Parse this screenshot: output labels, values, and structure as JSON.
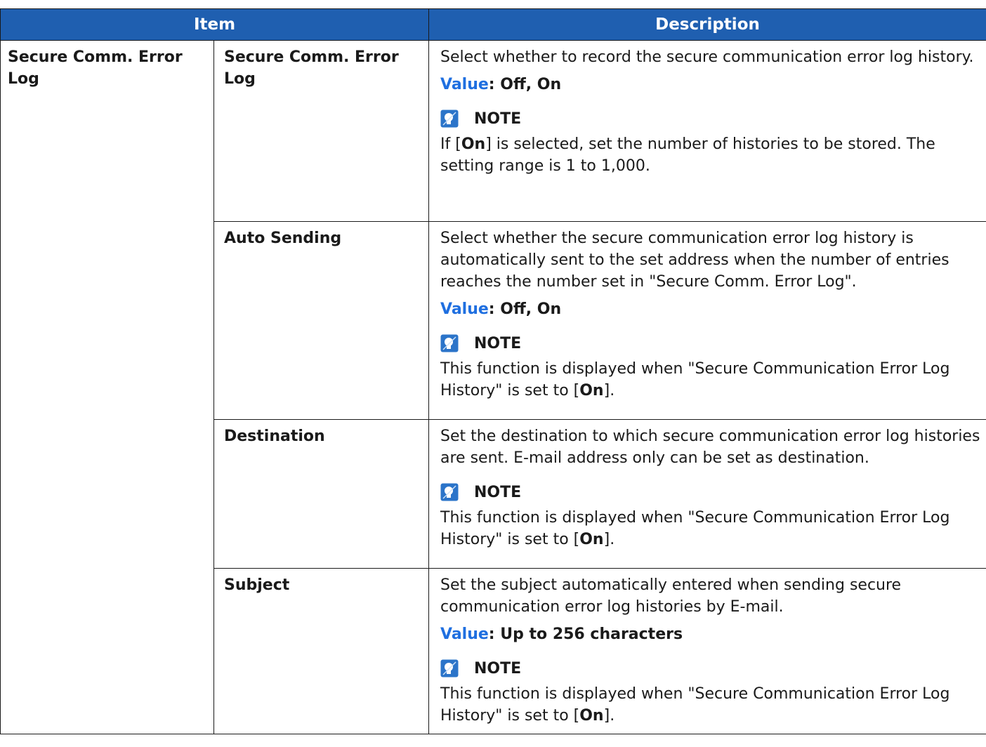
{
  "header": {
    "item": "Item",
    "description": "Description"
  },
  "group": "Secure Comm. Error Log",
  "note_label": "NOTE",
  "value_key": "Value",
  "rows": [
    {
      "item": "Secure Comm. Error Log",
      "text": "Select whether to record the secure communication error log history.",
      "value": ": Off, On",
      "note": [
        "If [",
        "On",
        "] is selected, set the number of histories to be stored. The setting range is 1 to 1,000."
      ]
    },
    {
      "item": "Auto Sending",
      "text": "Select whether the secure communication error log history is automatically sent to the set address when the number of entries reaches the number set in \"Secure Comm. Error Log\".",
      "value": ": Off, On",
      "note": [
        "This function is displayed when \"Secure Communication Error Log History\" is set to [",
        "On",
        "]."
      ]
    },
    {
      "item": "Destination",
      "text": "Set the destination to which secure communication error log histories are sent. E-mail address only can be set as destination.",
      "note": [
        "This function is displayed when \"Secure Communication Error Log History\" is set to [",
        "On",
        "]."
      ]
    },
    {
      "item": "Subject",
      "text": "Set the subject automatically entered when sending secure communication error log histories by E-mail.",
      "value": ": Up to 256 characters",
      "note": [
        "This function is displayed when \"Secure Communication Error Log History\" is set to [",
        "On",
        "]."
      ]
    }
  ],
  "colors": {
    "header_bg": "#1f5fb0",
    "value_key": "#1f6fe0"
  },
  "icons": {
    "note": "note-lightbulb-icon"
  }
}
